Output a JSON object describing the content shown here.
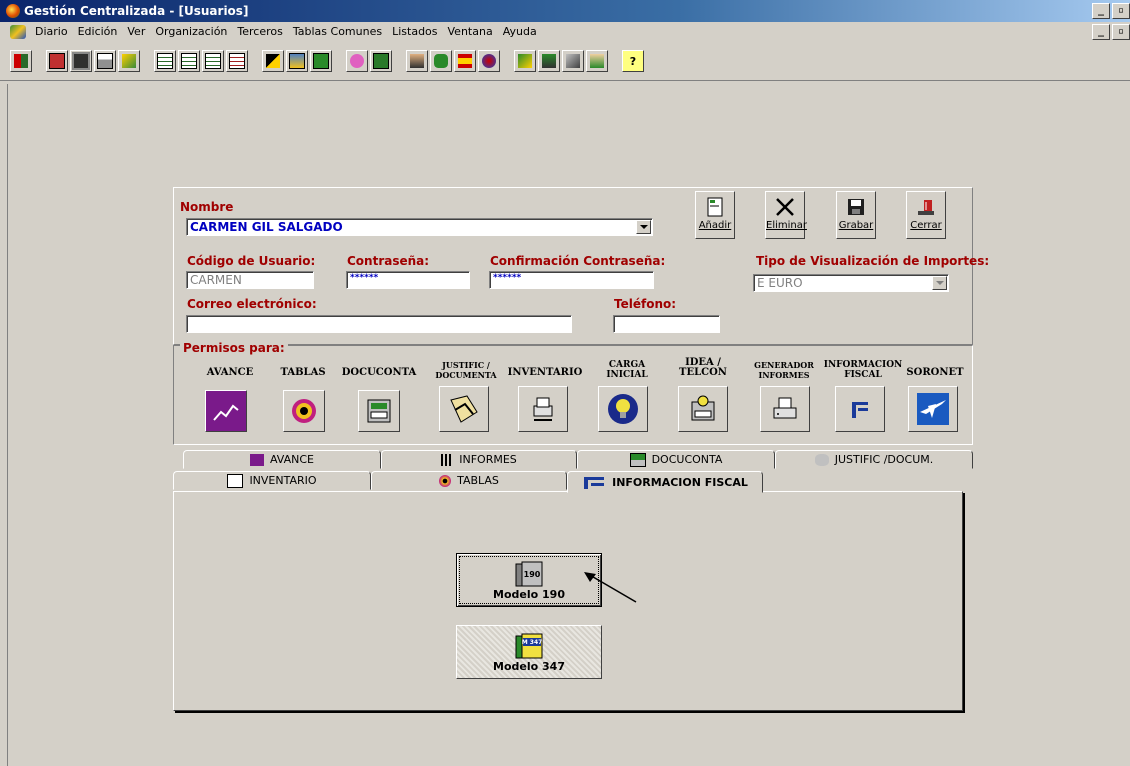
{
  "window": {
    "title": "Gestión Centralizada - [Usuarios]"
  },
  "window_buttons": [
    "_",
    "▫",
    "X"
  ],
  "menu": [
    "Diario",
    "Edición",
    "Ver",
    "Organización",
    "Terceros",
    "Tablas Comunes",
    "Listados",
    "Ventana",
    "Ayuda"
  ],
  "toolbar_icons": [
    "exit-icon",
    "new-doc-icon",
    "save-icon",
    "print-icon",
    "map-icon",
    "grid1-icon",
    "grid2-icon",
    "grid3-icon",
    "grid4-icon",
    "edit-icon",
    "calc-icon",
    "money-icon",
    "piggy-icon",
    "cash-icon",
    "person-icon",
    "spain-map-icon",
    "flag-icon",
    "globe-icon",
    "org-icon",
    "people-icon",
    "tools-icon",
    "handshake-icon",
    "help-icon"
  ],
  "form": {
    "nombre_label": "Nombre",
    "nombre_value": "CARMEN GIL SALGADO",
    "codigo_label": "Código de Usuario:",
    "codigo_value": "CARMEN",
    "pass_label": "Contraseña:",
    "pass_value": "******",
    "confirm_label": "Confirmación Contraseña:",
    "confirm_value": "******",
    "tipo_label": "Tipo de Visualización de Importes:",
    "tipo_value": "E EURO",
    "correo_label": "Correo electrónico:",
    "correo_value": "",
    "telefono_label": "Teléfono:",
    "telefono_value": ""
  },
  "actions": {
    "add": "Añadir",
    "delete": "Eliminar",
    "save": "Grabar",
    "close": "Cerrar"
  },
  "permisos": {
    "title": "Permisos para:",
    "items": [
      {
        "l1": "AVANCE",
        "l2": ""
      },
      {
        "l1": "TABLAS",
        "l2": ""
      },
      {
        "l1": "DOCUCONTA",
        "l2": ""
      },
      {
        "l1": "JUSTIFIC /",
        "l2": "DOCUMENTA"
      },
      {
        "l1": "INVENTARIO",
        "l2": ""
      },
      {
        "l1": "CARGA",
        "l2": "INICIAL"
      },
      {
        "l1": "IDEA /",
        "l2": "TELCON"
      },
      {
        "l1": "GENERADOR",
        "l2": "INFORMES"
      },
      {
        "l1": "INFORMACION",
        "l2": "FISCAL"
      },
      {
        "l1": "SORONET",
        "l2": ""
      }
    ]
  },
  "tabs": {
    "row1": [
      "AVANCE",
      "INFORMES",
      "DOCUCONTA",
      "JUSTIFIC /DOCUM."
    ],
    "row2": [
      "INVENTARIO",
      "TABLAS",
      "INFORMACION FISCAL"
    ]
  },
  "models": {
    "m190": "Modelo 190",
    "m190_icon_text": "190",
    "m347": "Modelo 347",
    "m347_icon_text": "M 347"
  }
}
